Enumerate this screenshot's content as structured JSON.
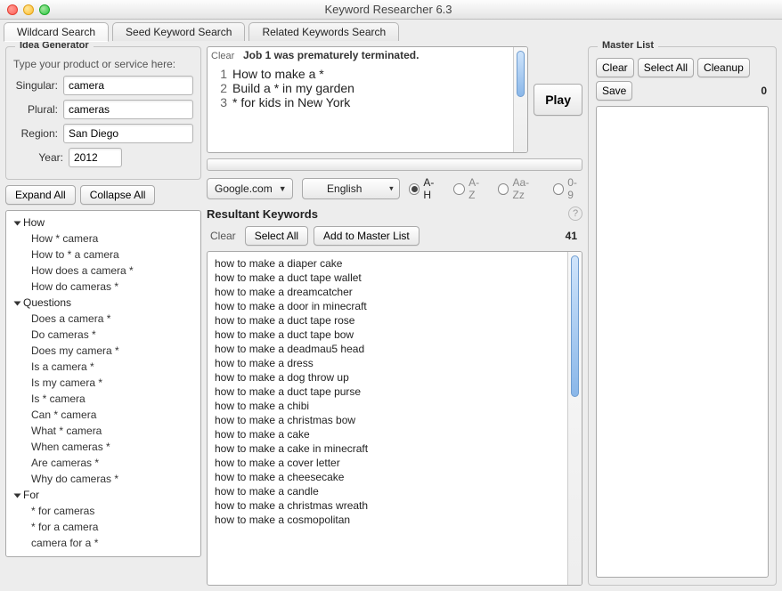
{
  "title": "Keyword Researcher 6.3",
  "tabs": [
    "Wildcard Search",
    "Seed Keyword Search",
    "Related Keywords Search"
  ],
  "master": {
    "title": "Master List",
    "buttons": {
      "clear": "Clear",
      "select_all": "Select All",
      "cleanup": "Cleanup",
      "save": "Save"
    },
    "count": "0"
  },
  "idea_generator": {
    "title": "Idea Generator",
    "hint": "Type your product or service here:",
    "labels": {
      "singular": "Singular:",
      "plural": "Plural:",
      "region": "Region:",
      "year": "Year:"
    },
    "values": {
      "singular": "camera",
      "plural": "cameras",
      "region": "San Diego",
      "year": "2012"
    },
    "expand_all": "Expand All",
    "collapse_all": "Collapse All",
    "tree": [
      {
        "label": "How",
        "children": [
          "How * camera",
          "How to * a camera",
          "How does a camera *",
          "How do cameras *"
        ]
      },
      {
        "label": "Questions",
        "children": [
          "Does a camera *",
          "Do cameras *",
          "Does my camera *",
          "Is a camera *",
          "Is my camera *",
          "Is * camera",
          "Can * camera",
          "What * camera",
          "When cameras *",
          "Are cameras *",
          "Why do cameras *"
        ]
      },
      {
        "label": "For",
        "children": [
          "* for cameras",
          "* for a camera",
          "camera for a *"
        ]
      }
    ]
  },
  "status": {
    "clear_label": "Clear",
    "message": "Job 1 was prematurely terminated.",
    "play_label": "Play",
    "lines": [
      "How to make a *",
      "Build a * in my garden",
      "* for kids in New York"
    ]
  },
  "search_options": {
    "engine": "Google.com",
    "language": "English",
    "ranges": [
      "A-H",
      "A-Z",
      "Aa-Zz",
      "0-9"
    ],
    "selected_range_index": 0
  },
  "resultant": {
    "title": "Resultant Keywords",
    "clear": "Clear",
    "select_all": "Select All",
    "add": "Add to Master List",
    "count": "41",
    "items": [
      "how to make a diaper cake",
      "how to make a duct tape wallet",
      "how to make a dreamcatcher",
      "how to make a door in minecraft",
      "how to make a duct tape rose",
      "how to make a duct tape bow",
      "how to make a deadmau5 head",
      "how to make a dress",
      "how to make a dog throw up",
      "how to make a duct tape purse",
      "how to make a chibi",
      "how to make a christmas bow",
      "how to make a cake",
      "how to make a cake in minecraft",
      "how to make a cover letter",
      "how to make a cheesecake",
      "how to make a candle",
      "how to make a christmas wreath",
      "how to make a cosmopolitan"
    ]
  }
}
